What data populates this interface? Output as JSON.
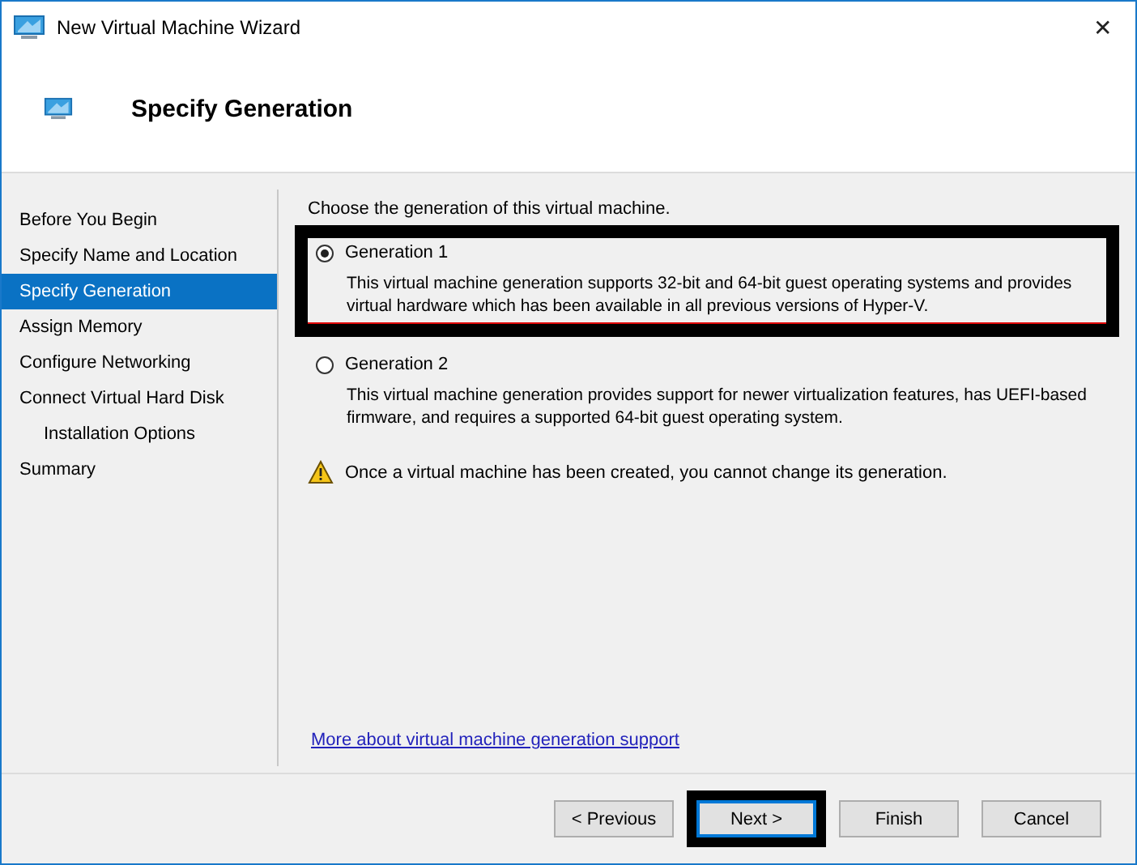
{
  "window": {
    "title": "New Virtual Machine Wizard",
    "close": "✕"
  },
  "header": {
    "title": "Specify Generation"
  },
  "sidebar": {
    "items": [
      {
        "label": "Before You Begin",
        "selected": false
      },
      {
        "label": "Specify Name and Location",
        "selected": false
      },
      {
        "label": "Specify Generation",
        "selected": true
      },
      {
        "label": "Assign Memory",
        "selected": false
      },
      {
        "label": "Configure Networking",
        "selected": false
      },
      {
        "label": "Connect Virtual Hard Disk",
        "selected": false,
        "children": [
          {
            "label": "Installation Options",
            "selected": false
          }
        ]
      },
      {
        "label": "Summary",
        "selected": false
      }
    ]
  },
  "content": {
    "prompt": "Choose the generation of this virtual machine.",
    "options": [
      {
        "label": "Generation 1",
        "selected": true,
        "highlighted": true,
        "description": "This virtual machine generation supports 32-bit and 64-bit guest operating systems and provides virtual hardware which has been available in all previous versions of Hyper-V."
      },
      {
        "label": "Generation 2",
        "selected": false,
        "highlighted": false,
        "description": "This virtual machine generation provides support for newer virtualization features, has UEFI-based firmware, and requires a supported 64-bit guest operating system."
      }
    ],
    "warning": "Once a virtual machine has been created, you cannot change its generation.",
    "link": "More about virtual machine generation support"
  },
  "buttons": [
    {
      "label": "< Previous",
      "default": false,
      "highlighted": false
    },
    {
      "label": "Next >",
      "default": true,
      "highlighted": true
    },
    {
      "label": "Finish",
      "default": false,
      "highlighted": false
    },
    {
      "label": "Cancel",
      "default": false,
      "highlighted": false
    }
  ]
}
